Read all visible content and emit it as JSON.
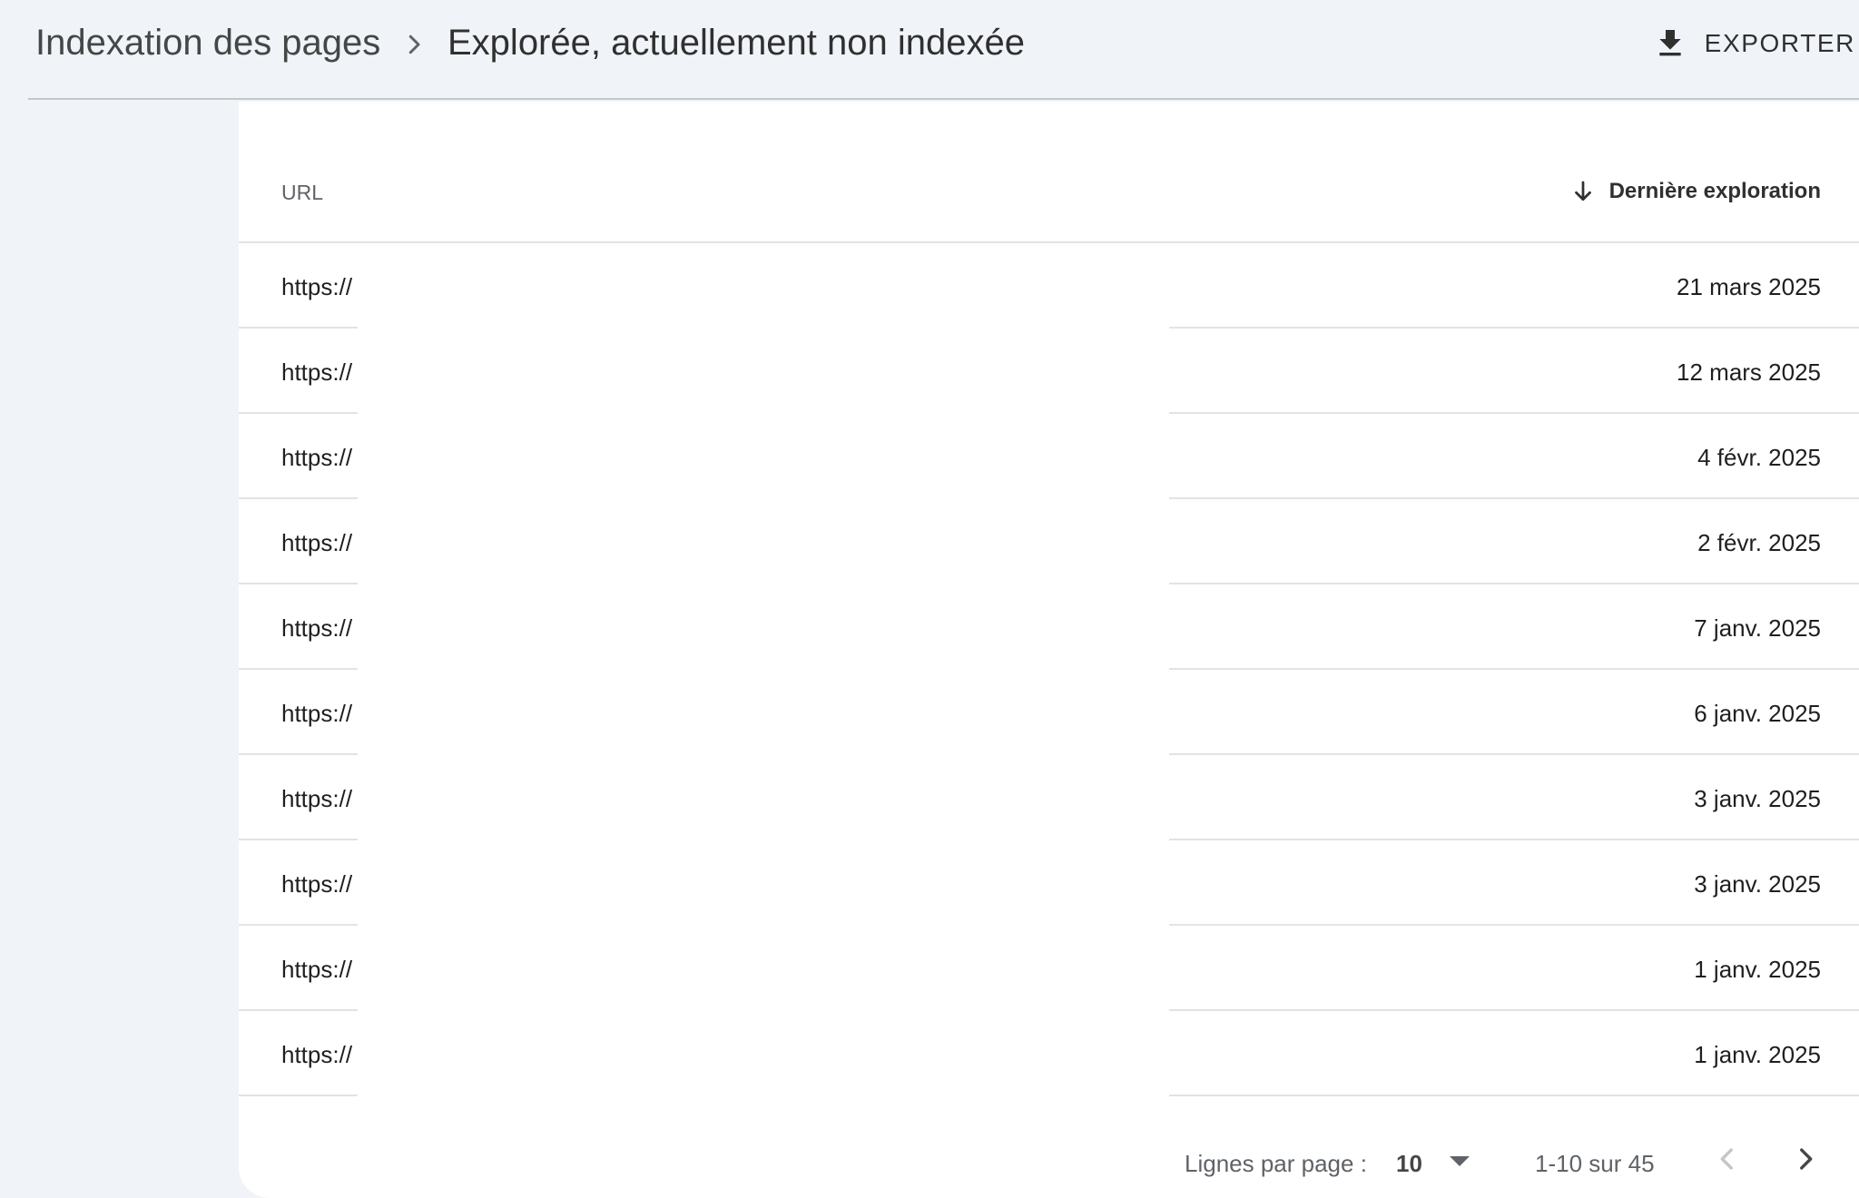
{
  "header": {
    "breadcrumb_parent": "Indexation des pages",
    "breadcrumb_current": "Explorée, actuellement non indexée",
    "export_label": "EXPORTER"
  },
  "table": {
    "columns": {
      "url": "URL",
      "last_crawl": "Dernière exploration"
    },
    "rows": [
      {
        "url": "https://",
        "date": "21 mars 2025"
      },
      {
        "url": "https://",
        "date": "12 mars 2025"
      },
      {
        "url": "https://",
        "date": "4 févr. 2025"
      },
      {
        "url": "https://",
        "date": "2 févr. 2025"
      },
      {
        "url": "https://",
        "date": "7 janv. 2025"
      },
      {
        "url": "https://",
        "date": "6 janv. 2025"
      },
      {
        "url": "https://",
        "date": "3 janv. 2025"
      },
      {
        "url": "https://",
        "date": "3 janv. 2025"
      },
      {
        "url": "https://",
        "date": "1 janv. 2025"
      },
      {
        "url": "https://",
        "date": "1 janv. 2025"
      }
    ]
  },
  "pagination": {
    "rows_per_page_label": "Lignes par page :",
    "rows_per_page_value": "10",
    "range_text": "1-10 sur 45"
  },
  "icons": {
    "export": "download-icon",
    "sort": "arrow-down-icon",
    "separator": "chevron-right-icon",
    "prev": "chevron-left-icon",
    "next": "chevron-right-icon"
  },
  "colors": {
    "background": "#f0f4f9",
    "card": "#ffffff",
    "divider": "#e3e3e3",
    "text_primary": "#1f1f1f",
    "text_secondary": "#5f6368"
  }
}
